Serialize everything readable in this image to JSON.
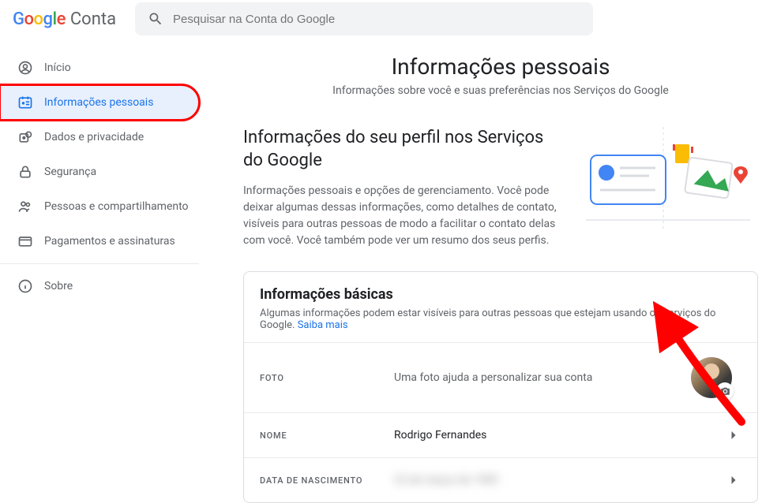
{
  "header": {
    "logo_product": "Conta",
    "search_placeholder": "Pesquisar na Conta do Google"
  },
  "sidebar": {
    "items": [
      {
        "label": "Início",
        "icon": "user-circle-icon"
      },
      {
        "label": "Informações pessoais",
        "icon": "id-card-icon"
      },
      {
        "label": "Dados e privacidade",
        "icon": "privacy-icon"
      },
      {
        "label": "Segurança",
        "icon": "lock-icon"
      },
      {
        "label": "Pessoas e compartilhamento",
        "icon": "people-icon"
      },
      {
        "label": "Pagamentos e assinaturas",
        "icon": "payments-icon"
      }
    ],
    "about": {
      "label": "Sobre",
      "icon": "info-icon"
    }
  },
  "page": {
    "title": "Informações pessoais",
    "subtitle": "Informações sobre você e suas preferências nos Serviços do Google"
  },
  "profile_section": {
    "heading": "Informações do seu perfil nos Serviços do Google",
    "description": "Informações pessoais e opções de gerenciamento. Você pode deixar algumas dessas informações, como detalhes de contato, visíveis para outras pessoas de modo a facilitar o contato delas com você. Você também pode ver um resumo dos seus perfis."
  },
  "basic_info_card": {
    "title": "Informações básicas",
    "subtitle": "Algumas informações podem estar visíveis para outras pessoas que estejam usando os serviços do Google.",
    "learn_more": "Saiba mais",
    "rows": {
      "photo": {
        "label": "FOTO",
        "value": "Uma foto ajuda a personalizar sua conta"
      },
      "name": {
        "label": "NOME",
        "value": "Rodrigo Fernandes"
      },
      "birthdate": {
        "label": "DATA DE NASCIMENTO",
        "value": "22 de março de 1985"
      }
    }
  }
}
